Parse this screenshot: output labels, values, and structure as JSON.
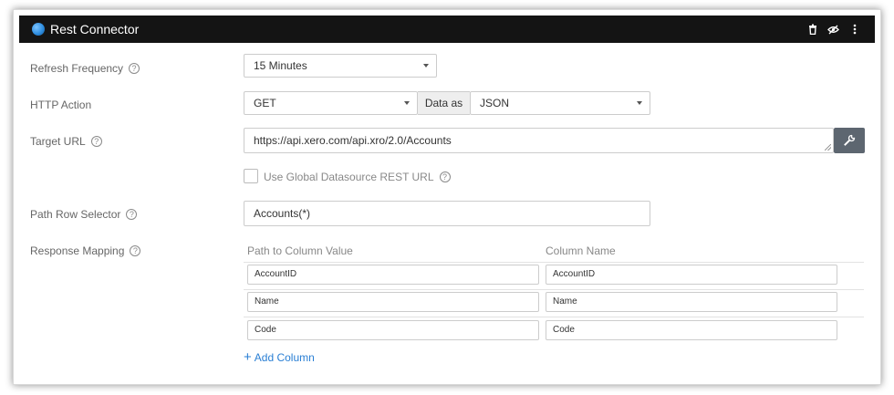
{
  "window": {
    "title": "Rest Connector",
    "icons": [
      "trash-icon",
      "eye-slash-icon",
      "more-vertical-icon"
    ]
  },
  "form": {
    "refresh_frequency": {
      "label": "Refresh Frequency",
      "value": "15 Minutes"
    },
    "http_action": {
      "label": "HTTP Action",
      "value": "GET",
      "data_as_label": "Data as",
      "data_as_value": "JSON"
    },
    "target_url": {
      "label": "Target URL",
      "value": "https://api.xero.com/api.xro/2.0/Accounts"
    },
    "use_global": {
      "label": "Use Global Datasource REST URL",
      "checked": false
    },
    "path_row_selector": {
      "label": "Path Row Selector",
      "value": "Accounts(*)"
    },
    "response_mapping": {
      "label": "Response Mapping",
      "col_path_header": "Path to Column Value",
      "col_name_header": "Column Name",
      "rows": [
        {
          "path": "AccountID",
          "name": "AccountID"
        },
        {
          "path": "Name",
          "name": "Name"
        },
        {
          "path": "Code",
          "name": "Code"
        }
      ],
      "add_column_label": "Add Column"
    }
  },
  "colors": {
    "titlebar": "#141414",
    "accent_link": "#2a7fd4",
    "wrench_button": "#5d6670"
  }
}
